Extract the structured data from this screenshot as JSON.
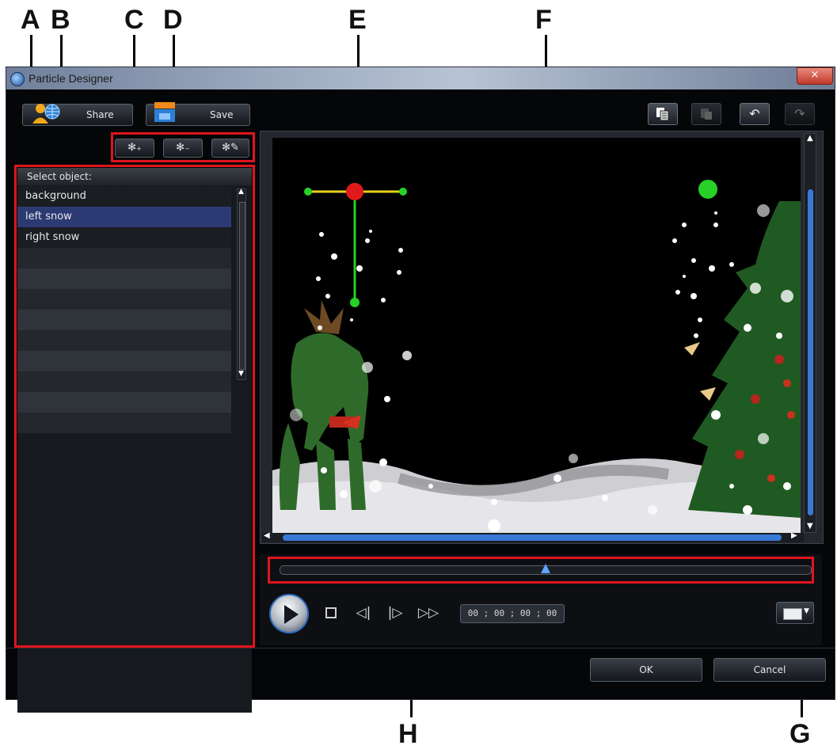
{
  "callouts": [
    "A",
    "B",
    "C",
    "D",
    "E",
    "F",
    "G",
    "H"
  ],
  "window": {
    "title": "Particle Designer",
    "close_label": "×"
  },
  "toolbar": {
    "share_label": "Share",
    "save_label": "Save",
    "particle_tools": [
      "add-particle-object",
      "remove-particle-object",
      "edit-particle-object"
    ],
    "right_tools": [
      "copy-icon",
      "paste-icon",
      "undo-icon",
      "redo-icon"
    ]
  },
  "object_panel": {
    "header": "Select object:",
    "items": [
      "background",
      "left snow",
      "right snow"
    ],
    "selected_index": 1
  },
  "playback": {
    "timecode": "00 ; 00 ; 00 ; 00",
    "slider_position": 0.5
  },
  "dialog": {
    "ok_label": "OK",
    "cancel_label": "Cancel"
  },
  "colors": {
    "highlight_red": "#e0141e",
    "scrollbar_blue": "#3a78d8",
    "emitter_green": "#27d127",
    "selection_blue": "#2b3a73"
  }
}
